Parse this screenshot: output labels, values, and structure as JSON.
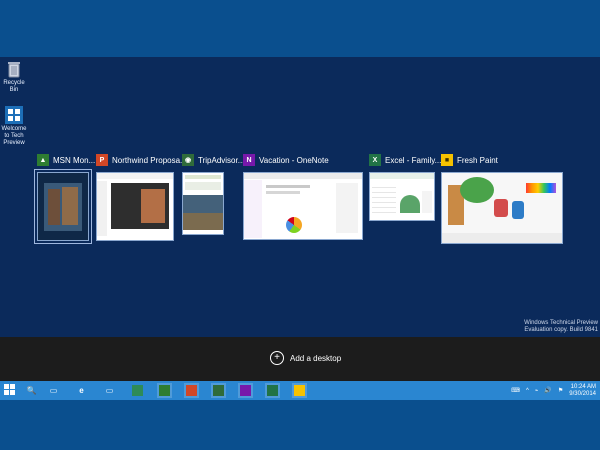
{
  "colors": {
    "desktop_bg": "#0b2a5b",
    "taskbar": "#2a86d1",
    "add_bar": "#1c1c1c",
    "msn_green": "#2e7d32",
    "office_red": "#d24726",
    "trip_green": "#2f6b3a",
    "onenote_purple": "#7719aa",
    "excel_green": "#217346",
    "paint_yellow": "#f6c200"
  },
  "desktop_icons": [
    {
      "label": "Recycle Bin",
      "icon": "recycle-bin-icon"
    },
    {
      "label": "Welcome to Tech Preview",
      "icon": "windows-logo-icon"
    }
  ],
  "windows": [
    {
      "title": "MSN Mon...",
      "icon": "msn-money-icon"
    },
    {
      "title": "Northwind Proposa...",
      "icon": "powerpoint-icon"
    },
    {
      "title": "TripAdvisor...",
      "icon": "tripadvisor-icon"
    },
    {
      "title": "Vacation - OneNote",
      "icon": "onenote-icon"
    },
    {
      "title": "Excel - Family...",
      "icon": "excel-icon"
    },
    {
      "title": "Fresh Paint",
      "icon": "fresh-paint-icon"
    }
  ],
  "add_desktop_label": "Add a desktop",
  "watermark": {
    "line1": "Windows Technical Preview",
    "line2": "Evaluation copy. Build 9841"
  },
  "taskbar_items": [
    {
      "name": "start-button",
      "icon": "windows-logo-icon"
    },
    {
      "name": "search-button",
      "icon": "search-icon"
    },
    {
      "name": "task-view-button",
      "icon": "task-view-icon"
    },
    {
      "name": "ie-button",
      "icon": "internet-explorer-icon"
    },
    {
      "name": "file-explorer-button",
      "icon": "folder-icon"
    },
    {
      "name": "store-button",
      "icon": "store-icon"
    },
    {
      "name": "msn-money-taskbar-button",
      "icon": "msn-money-icon"
    },
    {
      "name": "powerpoint-taskbar-button",
      "icon": "powerpoint-icon"
    },
    {
      "name": "tripadvisor-taskbar-button",
      "icon": "tripadvisor-icon"
    },
    {
      "name": "onenote-taskbar-button",
      "icon": "onenote-icon"
    },
    {
      "name": "excel-taskbar-button",
      "icon": "excel-icon"
    },
    {
      "name": "fresh-paint-taskbar-button",
      "icon": "fresh-paint-icon"
    }
  ],
  "clock": {
    "time": "10:24 AM",
    "date": "9/30/2014"
  }
}
